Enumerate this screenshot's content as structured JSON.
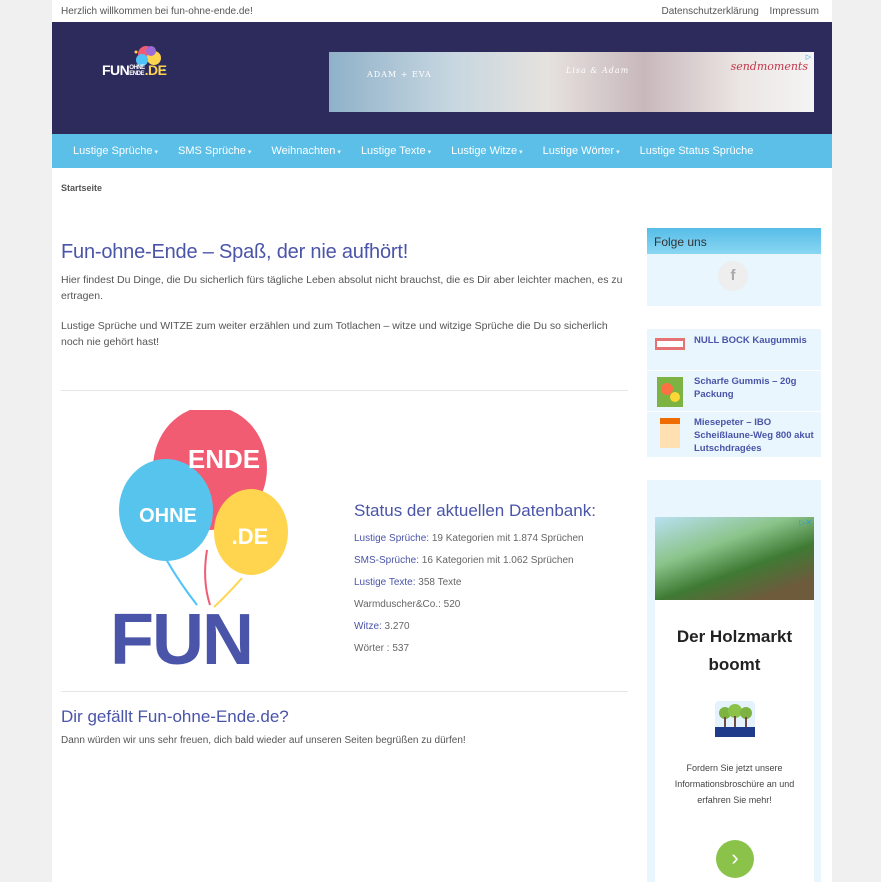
{
  "topbar": {
    "welcome": "Herzlich willkommen bei fun-ohne-ende.de!",
    "links": [
      "Datenschutzerklärung",
      "Impressum"
    ]
  },
  "logo": {
    "fun": "FUN",
    "ohne": "OHNE",
    "ende": "ENDE",
    "de": ".DE"
  },
  "header_ad": {
    "text1": "ADAM + EVA",
    "text2": "Lisa & Adam",
    "brand": "sendmoments"
  },
  "nav": {
    "items": [
      "Lustige Sprüche",
      "SMS Sprüche",
      "Weihnachten",
      "Lustige Texte",
      "Lustige Witze",
      "Lustige Wörter",
      "Lustige Status Sprüche"
    ],
    "caret": "▾"
  },
  "breadcrumb": "Startseite",
  "main": {
    "title": "Fun-ohne-Ende – Spaß, der nie aufhört!",
    "intro1": "Hier findest Du Dinge, die Du sicherlich fürs tägliche Leben absolut nicht brauchst, die es Dir aber leichter machen, es zu ertragen.",
    "intro2": "Lustige Sprüche und WITZE zum weiter erzählen und zum Totlachen – witze und witzige Sprüche die Du so sicherlich noch nie gehört hast!",
    "balloons": {
      "ende": "ENDE",
      "ohne": "OHNE",
      "de": ".DE",
      "fun": "FUN"
    },
    "stats_title": "Status der aktuellen Datenbank:",
    "stats": [
      {
        "label": "Lustige Sprüche:",
        "value": " 19 Kategorien mit 1.874 Sprüchen"
      },
      {
        "label": "SMS-Sprüche:",
        "value": " 16 Kategorien mit 1.062 Sprüchen"
      },
      {
        "label": "Lustige Texte:",
        "value": " 358 Texte"
      },
      {
        "label": "",
        "value": "Warmduscher&Co.: 520"
      },
      {
        "label": "Witze:",
        "value": " 3.270"
      },
      {
        "label": "",
        "value": "Wörter : 537"
      }
    ],
    "like_title": "Dir gefällt Fun-ohne-Ende.de?",
    "like_text": "Dann würden wir uns sehr freuen, dich bald wieder auf unseren Seiten begrüßen zu dürfen!"
  },
  "sidebar": {
    "follow_title": "Folge uns",
    "fb_glyph": "f",
    "products": [
      {
        "name": "NULL BOCK Kaugummis"
      },
      {
        "name": "Scharfe Gummis – 20g Packung"
      },
      {
        "name": "Miesepeter – IBO Scheißlaune-Weg 800 akut Lutschdragées"
      }
    ],
    "ad": {
      "headline": "Der Holzmarkt boomt",
      "body": "Fordern Sie jetzt unsere Informationsbroschüre an und erfahren Sie mehr!",
      "go": "›",
      "choice": "▷✕"
    }
  },
  "colors": {
    "header_bg": "#2c2b5c",
    "nav_bg": "#5bbfe8",
    "link": "#4a54a8",
    "sidebar_bg": "#e9f6fd"
  }
}
